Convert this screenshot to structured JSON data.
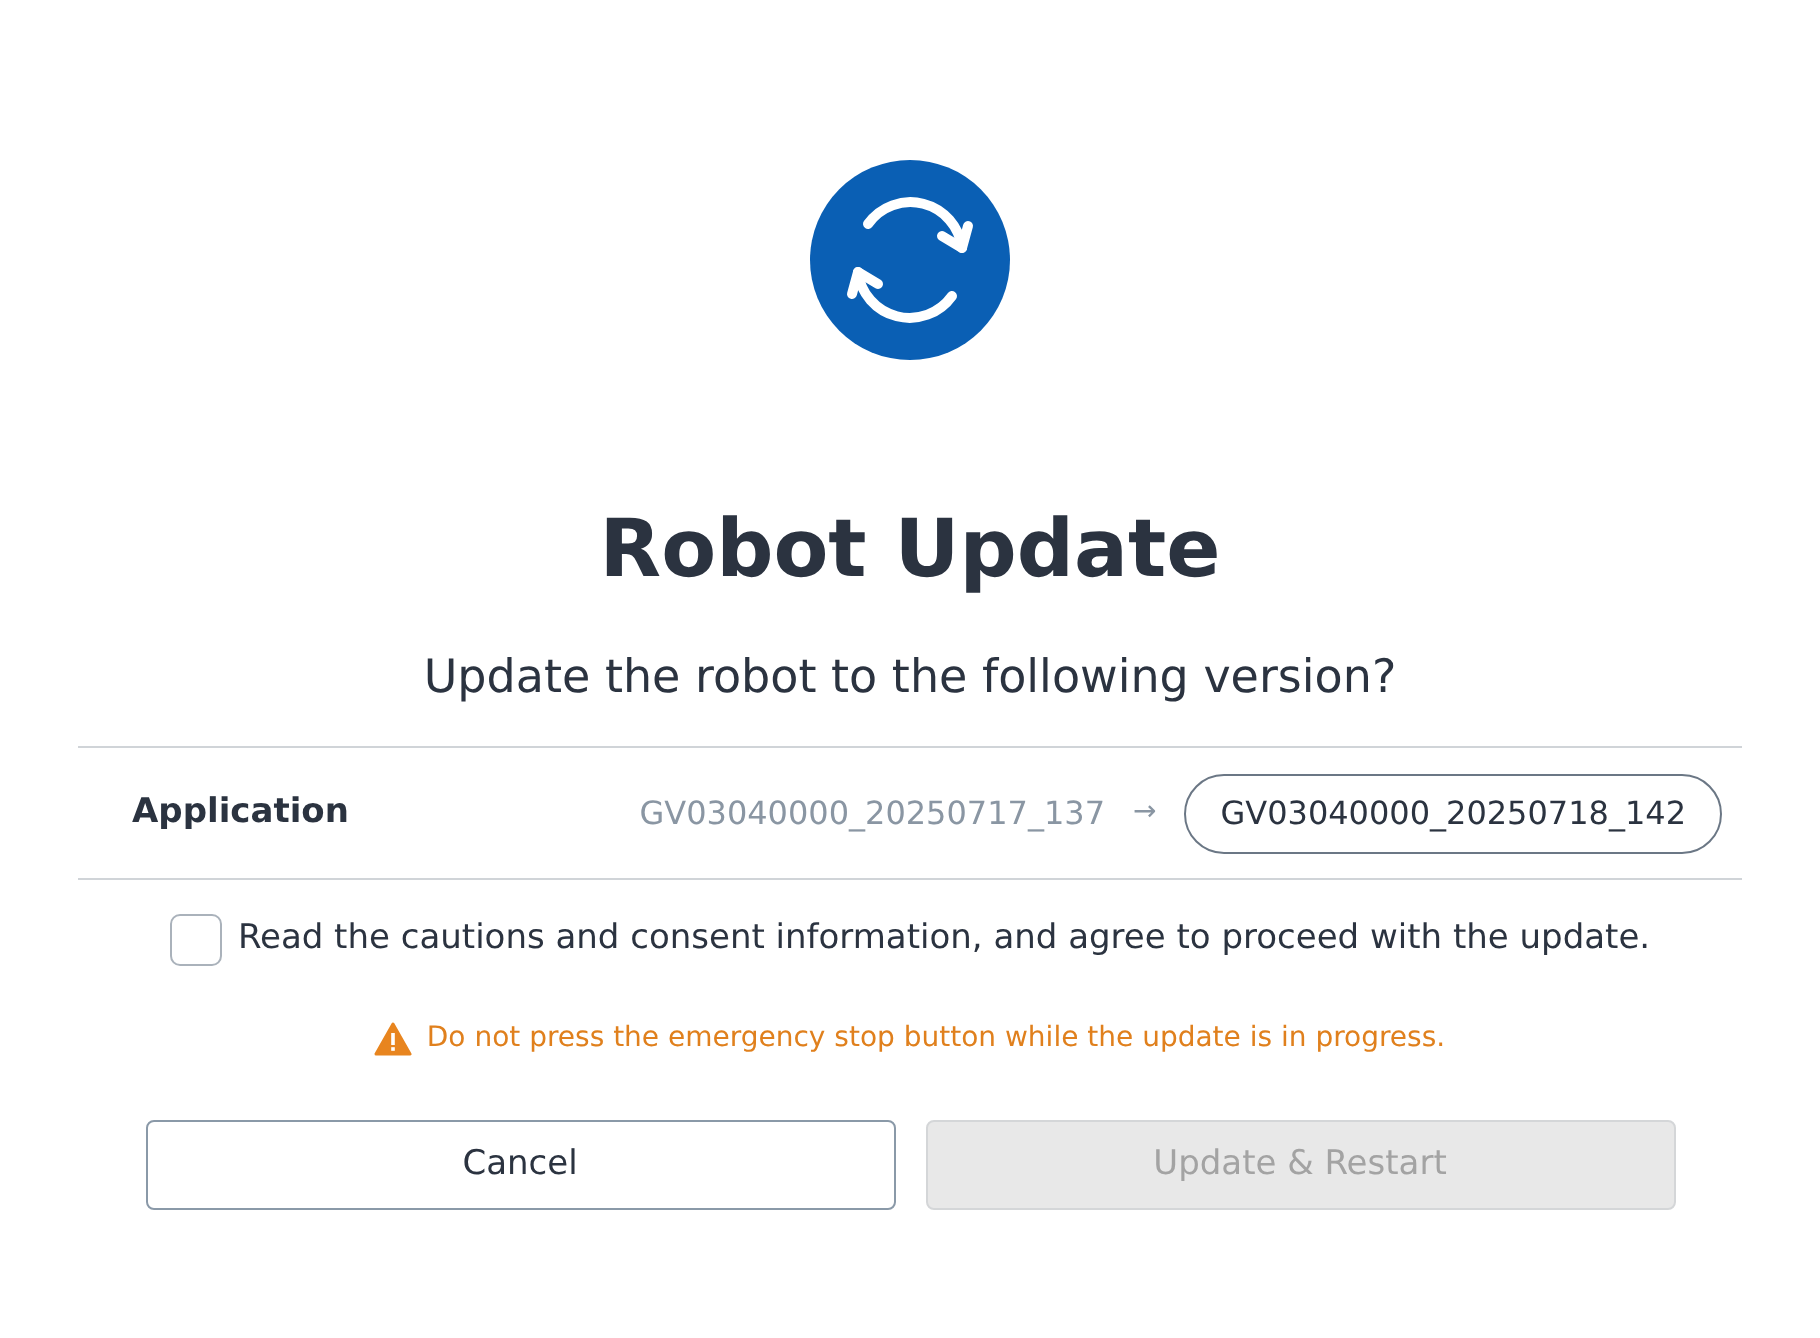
{
  "title": "Robot Update",
  "question": "Update the robot to the following version?",
  "version_row": {
    "label": "Application",
    "current": "GV03040000_20250717_137",
    "arrow": "→",
    "target": "GV03040000_20250718_142"
  },
  "consent": {
    "text": "Read the cautions and consent information, and agree to proceed with the update.",
    "checked": false
  },
  "warning": "Do not press the emergency stop button while the update is in progress.",
  "buttons": [
    {
      "label": "Cancel",
      "disabled": false
    },
    {
      "label": "Update & Restart",
      "disabled": true
    }
  ]
}
